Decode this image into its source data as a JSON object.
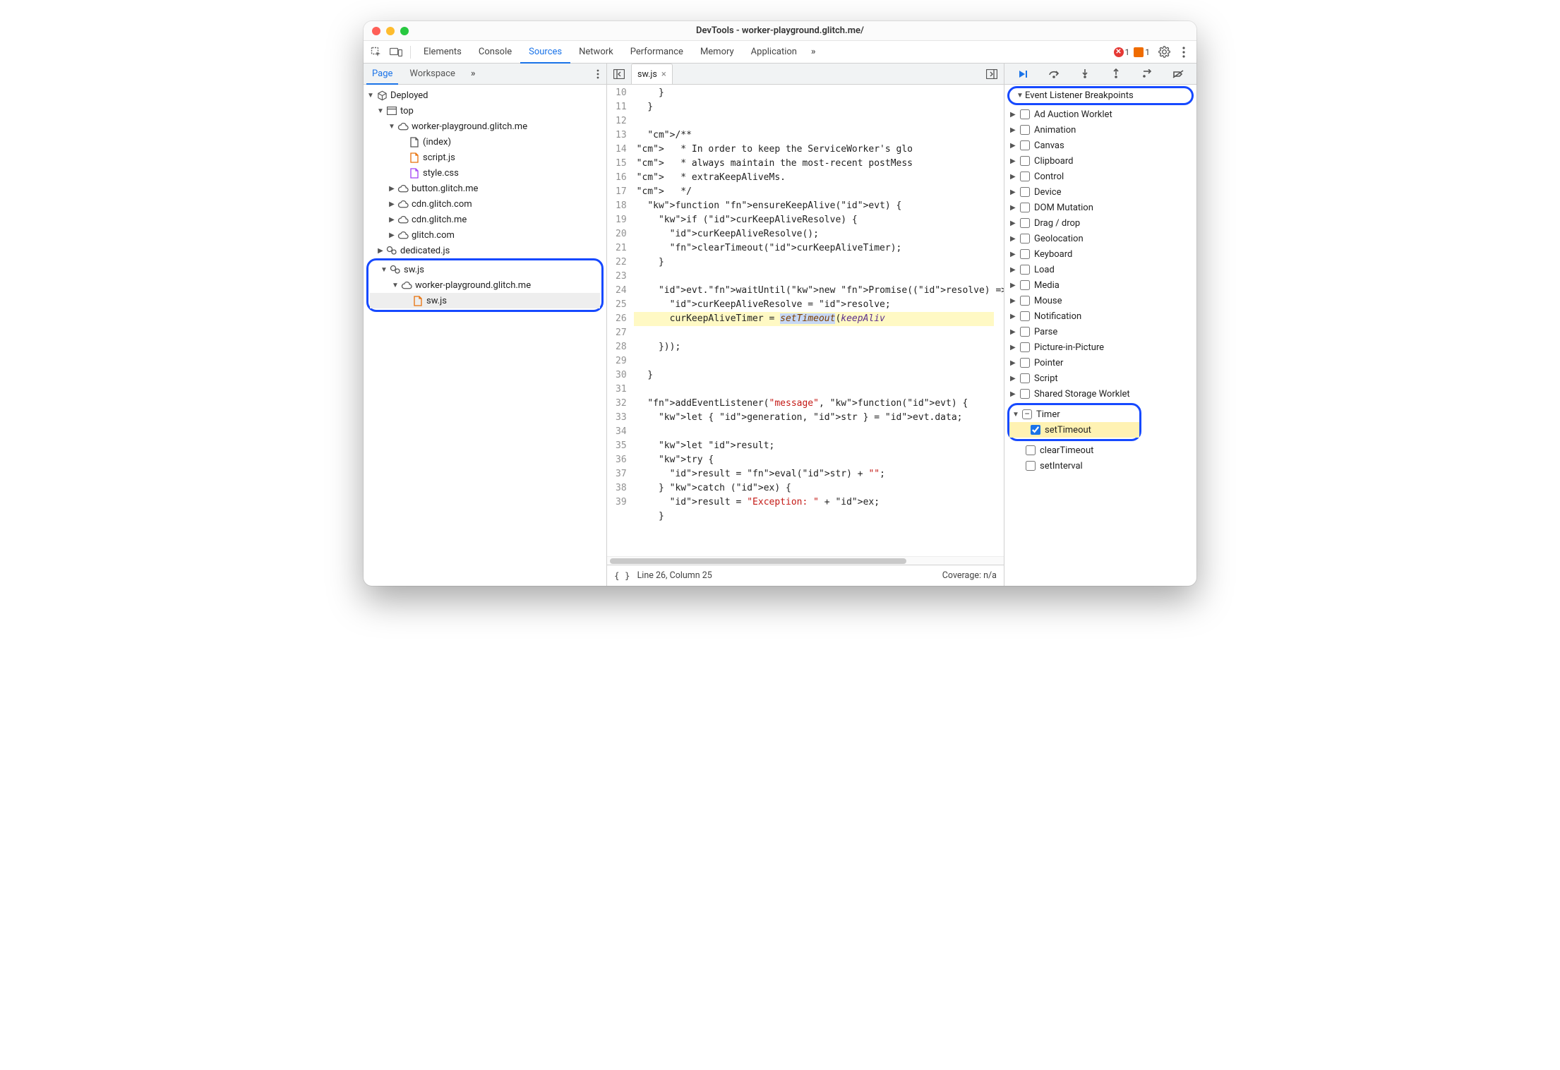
{
  "window": {
    "title": "DevTools - worker-playground.glitch.me/"
  },
  "mainTabs": {
    "items": [
      "Elements",
      "Console",
      "Sources",
      "Network",
      "Performance",
      "Memory",
      "Application"
    ],
    "active": "Sources",
    "errorCount": "1",
    "warnCount": "1"
  },
  "navigator": {
    "tabs": {
      "active": "Page",
      "other": "Workspace"
    }
  },
  "fileTree": {
    "root": "Deployed",
    "top": "top",
    "domains": [
      {
        "name": "worker-playground.glitch.me",
        "expanded": true,
        "files": [
          {
            "name": "(index)",
            "kind": "doc"
          },
          {
            "name": "script.js",
            "kind": "js"
          },
          {
            "name": "style.css",
            "kind": "css"
          }
        ]
      },
      {
        "name": "button.glitch.me",
        "expanded": false
      },
      {
        "name": "cdn.glitch.com",
        "expanded": false
      },
      {
        "name": "cdn.glitch.me",
        "expanded": false
      },
      {
        "name": "glitch.com",
        "expanded": false
      }
    ],
    "workers": [
      {
        "name": "dedicated.js",
        "expanded": false
      },
      {
        "name": "sw.js",
        "expanded": true,
        "children": [
          {
            "name": "worker-playground.glitch.me",
            "kind": "cloud",
            "expanded": true,
            "files": [
              {
                "name": "sw.js",
                "kind": "js",
                "selected": true
              }
            ]
          }
        ]
      }
    ]
  },
  "editor": {
    "fileName": "sw.js",
    "startLine": 10,
    "statusLine": "Line 26, Column 25",
    "coverage": "Coverage: n/a",
    "lines": [
      "    }",
      "  }",
      "",
      "  /**",
      "   * In order to keep the ServiceWorker's glo",
      "   * always maintain the most-recent postMess",
      "   * extraKeepAliveMs.",
      "   */",
      "  function ensureKeepAlive(evt) {",
      "    if (curKeepAliveResolve) {",
      "      curKeepAliveResolve();",
      "      clearTimeout(curKeepAliveTimer);",
      "    }",
      "",
      "    evt.waitUntil(new Promise((resolve) => {",
      "      curKeepAliveResolve = resolve;",
      "      curKeepAliveTimer = setTimeout(keepAliv",
      "    }));",
      "",
      "  }",
      "",
      "  addEventListener(\"message\", function(evt) {",
      "    let { generation, str } = evt.data;",
      "",
      "    let result;",
      "    try {",
      "      result = eval(str) + \"\";",
      "    } catch (ex) {",
      "      result = \"Exception: \" + ex;",
      "    }"
    ]
  },
  "eventBreakpoints": {
    "title": "Event Listener Breakpoints",
    "categories": [
      "Ad Auction Worklet",
      "Animation",
      "Canvas",
      "Clipboard",
      "Control",
      "Device",
      "DOM Mutation",
      "Drag / drop",
      "Geolocation",
      "Keyboard",
      "Load",
      "Media",
      "Mouse",
      "Notification",
      "Parse",
      "Picture-in-Picture",
      "Pointer",
      "Script",
      "Shared Storage Worklet"
    ],
    "timer": {
      "label": "Timer",
      "items": [
        {
          "label": "setTimeout",
          "checked": true
        },
        {
          "label": "clearTimeout",
          "checked": false
        },
        {
          "label": "setInterval",
          "checked": false
        }
      ]
    }
  }
}
